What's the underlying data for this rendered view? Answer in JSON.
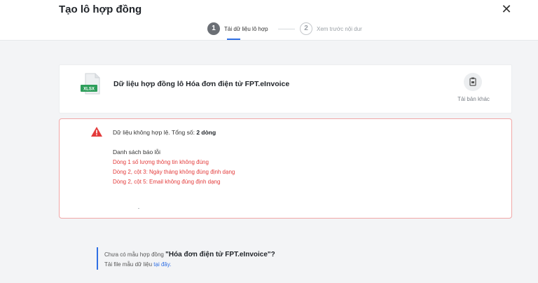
{
  "dialog": {
    "title": "Tạo lô hợp đồng",
    "close_symbol": "✕"
  },
  "steps": [
    {
      "number": "1",
      "label": "Tải dữ liệu lô hợp",
      "active": true
    },
    {
      "number": "2",
      "label": "Xem trước nội dur",
      "active": false
    }
  ],
  "file": {
    "badge": "XLSX",
    "name": "Dữ liệu hợp đồng lô Hóa đơn điện tử FPT.eInvoice",
    "reupload_label": "Tải bản khác"
  },
  "errors": {
    "summary_prefix": "Dữ liệu không hợp lệ. Tổng số: ",
    "summary_count": "2 dòng",
    "list_title": "Danh sách báo lỗi",
    "items": [
      "Dòng 1 số lượng thông tin không đúng",
      "Dòng 2, cột 3: Ngày tháng không đúng định dạng",
      "Dòng 2, cột 5: Email không đúng định dạng"
    ]
  },
  "hint": {
    "prefix": "Chưa có mẫu hợp đồng ",
    "template_name": "\"Hóa đơn điện tử FPT.eInvoice\"?",
    "download_prefix": "Tải file mẫu dữ liệu ",
    "download_link": "tại đây."
  },
  "colors": {
    "accent": "#2f6fe4",
    "error": "#e33b3b",
    "error_border": "#f0a7a7",
    "excel_green": "#2e9e5b"
  }
}
